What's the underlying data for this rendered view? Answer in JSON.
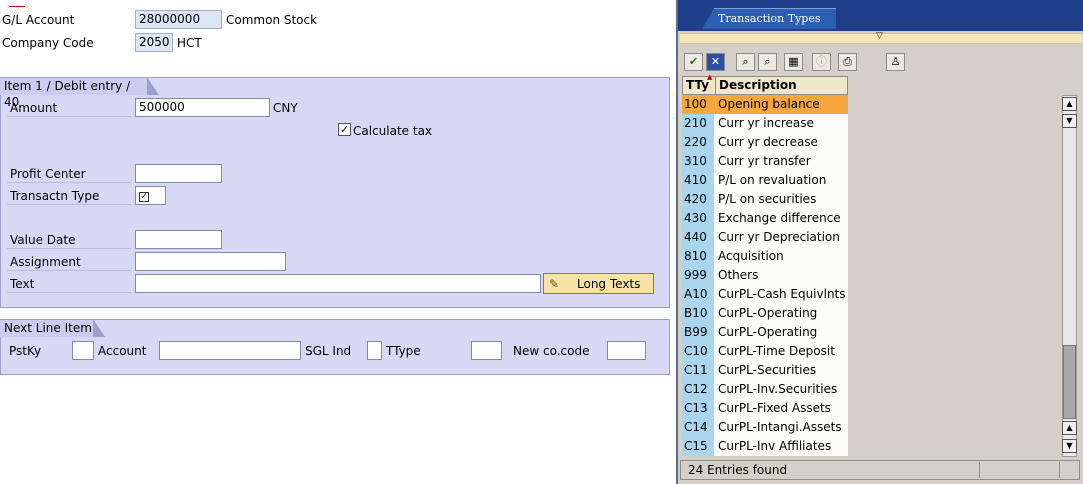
{
  "header": {
    "gl_account_label": "G/L Account",
    "gl_account_value": "28000000",
    "gl_account_desc": "Common Stock",
    "company_code_label": "Company Code",
    "company_code_value": "2050",
    "company_code_desc": "HCT"
  },
  "item": {
    "tab_label": "Item 1 / Debit entry / 40",
    "amount_label": "Amount",
    "amount_value": "500000",
    "currency": "CNY",
    "calculate_tax_label": "Calculate tax",
    "calculate_tax_checked": true,
    "profit_center_label": "Profit Center",
    "profit_center_value": "",
    "transaction_type_label": "Transactn Type",
    "value_date_label": "Value Date",
    "value_date_value": "",
    "assignment_label": "Assignment",
    "assignment_value": "",
    "text_label": "Text",
    "text_value": "",
    "long_texts_button": "Long Texts"
  },
  "next_line": {
    "tab_label": "Next Line Item",
    "pstky_label": "PstKy",
    "account_label": "Account",
    "sgl_ind_label": "SGL Ind",
    "ttype_label": "TType",
    "new_cocode_label": "New co.code"
  },
  "popup": {
    "tab_label": "Transaction Types",
    "col_key": "TTy",
    "col_desc": "Description",
    "selected_index": 0,
    "rows": [
      {
        "key": "100",
        "desc": "Opening balance"
      },
      {
        "key": "210",
        "desc": "Curr yr increase"
      },
      {
        "key": "220",
        "desc": "Curr yr decrease"
      },
      {
        "key": "310",
        "desc": "Curr yr transfer"
      },
      {
        "key": "410",
        "desc": "P/L on revaluation"
      },
      {
        "key": "420",
        "desc": "P/L on securities"
      },
      {
        "key": "430",
        "desc": "Exchange difference"
      },
      {
        "key": "440",
        "desc": "Curr yr Depreciation"
      },
      {
        "key": "810",
        "desc": "Acquisition"
      },
      {
        "key": "999",
        "desc": "Others"
      },
      {
        "key": "A10",
        "desc": "CurPL-Cash Equivlnts"
      },
      {
        "key": "B10",
        "desc": "CurPL-Operating"
      },
      {
        "key": "B99",
        "desc": "CurPL-Operating"
      },
      {
        "key": "C10",
        "desc": "CurPL-Time Deposit"
      },
      {
        "key": "C11",
        "desc": "CurPL-Securities"
      },
      {
        "key": "C12",
        "desc": "CurPL-Inv.Securities"
      },
      {
        "key": "C13",
        "desc": "CurPL-Fixed Assets"
      },
      {
        "key": "C14",
        "desc": "CurPL-Intangi.Assets"
      },
      {
        "key": "C15",
        "desc": "CurPL-Inv Affiliates"
      }
    ],
    "status": "24 Entries found",
    "toolbar_icons": [
      "check-icon",
      "cancel-icon",
      "find-icon",
      "find-next-icon",
      "selection-icon",
      "info-icon",
      "print-icon",
      "personal-value-list-icon"
    ],
    "accent": "#f5a63c"
  }
}
